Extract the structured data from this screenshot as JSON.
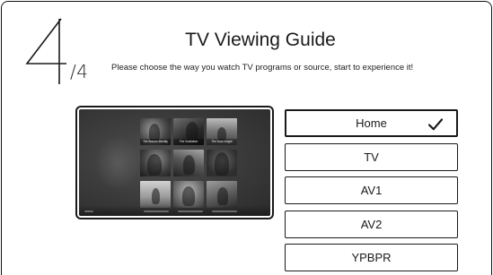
{
  "step": {
    "current": "4",
    "total": "/4"
  },
  "header": {
    "title": "TV Viewing Guide",
    "subtitle": "Please choose the way you watch TV programs or source, start to experience it!"
  },
  "preview": {
    "thumbnail_captions": [
      "The Bourne Identity",
      "The Godfather",
      "The Dark Knight",
      "",
      "",
      "",
      "",
      "",
      ""
    ]
  },
  "options": [
    {
      "label": "Home",
      "selected": true,
      "icon": "checkmark-icon"
    },
    {
      "label": "TV",
      "selected": false
    },
    {
      "label": "AV1",
      "selected": false
    },
    {
      "label": "AV2",
      "selected": false
    },
    {
      "label": "YPBPR",
      "selected": false
    }
  ],
  "colors": {
    "border": "#1a1a1a",
    "background": "#ffffff",
    "preview_bg": "#3e3e3e"
  }
}
